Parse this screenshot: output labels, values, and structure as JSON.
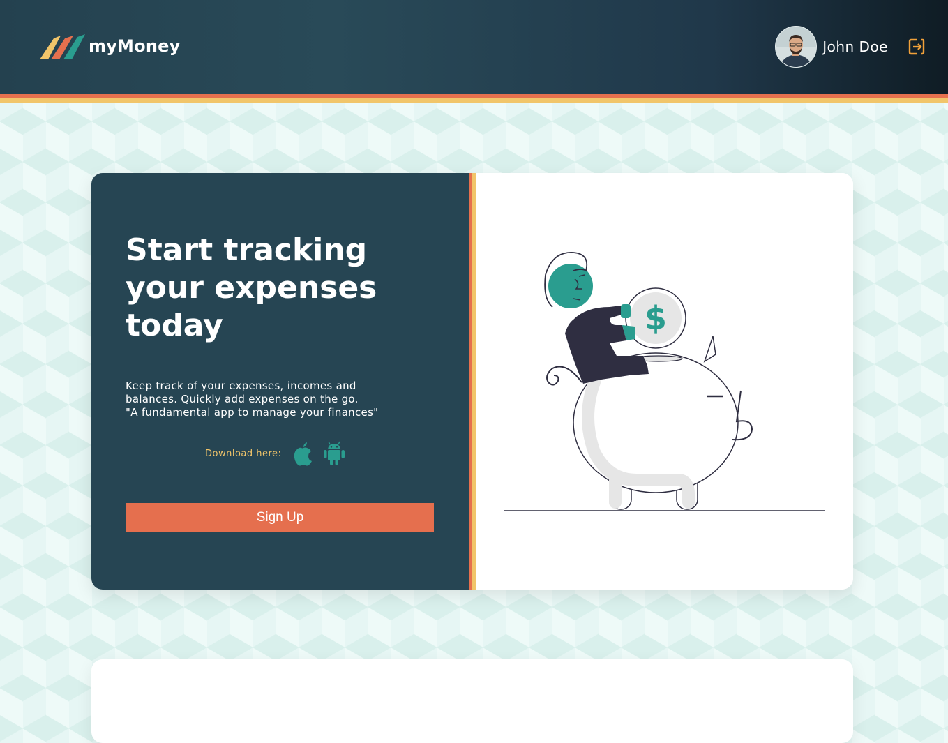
{
  "header": {
    "logo_text": "myMoney",
    "user_name": "John Doe",
    "logo_icon": "stripes-logo-icon",
    "logout_icon": "logout-icon"
  },
  "hero": {
    "headline": "Start tracking your expenses today",
    "description_lines": [
      "Keep track of your expenses, incomes and",
      "balances. Quickly add expenses on the go.",
      "\"A fundamental app to manage your finances\""
    ],
    "download_label": "Download here:",
    "download_icons": [
      "apple-icon",
      "android-icon"
    ],
    "signup_label": "Sign Up",
    "illustration": "piggy-bank-illustration"
  },
  "colors": {
    "header_dark": "#264553",
    "accent_coral": "#e56f4e",
    "accent_yellow": "#f1c56a",
    "accent_teal": "#2a9d8f",
    "background": "#e6f6f4"
  }
}
